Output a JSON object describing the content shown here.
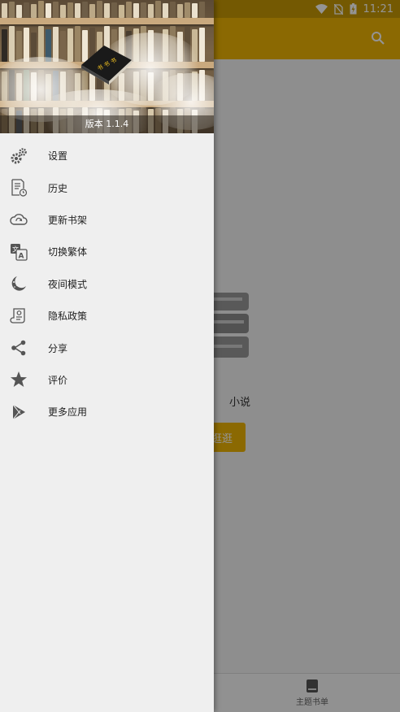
{
  "status_bar": {
    "time": "11:21",
    "icons": [
      "wifi-icon",
      "no-sim-icon",
      "battery-charging-icon"
    ]
  },
  "toolbar": {
    "search_icon": "search-icon"
  },
  "main": {
    "empty_text": "小说",
    "browse_button": "逛逛"
  },
  "bottom_nav": {
    "items": [
      {
        "label": "主题书单",
        "icon": "book-icon"
      }
    ]
  },
  "drawer": {
    "version": "版本 1.1.4",
    "logo_text": "书 书 书",
    "menu": [
      {
        "label": "设置",
        "icon": "gears-icon"
      },
      {
        "label": "历史",
        "icon": "history-icon"
      },
      {
        "label": "更新书架",
        "icon": "cloud-sync-icon"
      },
      {
        "label": "切换繁体",
        "icon": "translate-icon"
      },
      {
        "label": "夜间模式",
        "icon": "moon-icon"
      },
      {
        "label": "隐私政策",
        "icon": "privacy-scroll-icon"
      },
      {
        "label": "分享",
        "icon": "share-icon"
      },
      {
        "label": "评价",
        "icon": "star-icon"
      },
      {
        "label": "更多应用",
        "icon": "play-store-icon"
      }
    ]
  },
  "colors": {
    "accent": "#f0b604",
    "status_bar": "#c99a05",
    "drawer_bg": "#efefef",
    "icon_gray": "#555555"
  }
}
